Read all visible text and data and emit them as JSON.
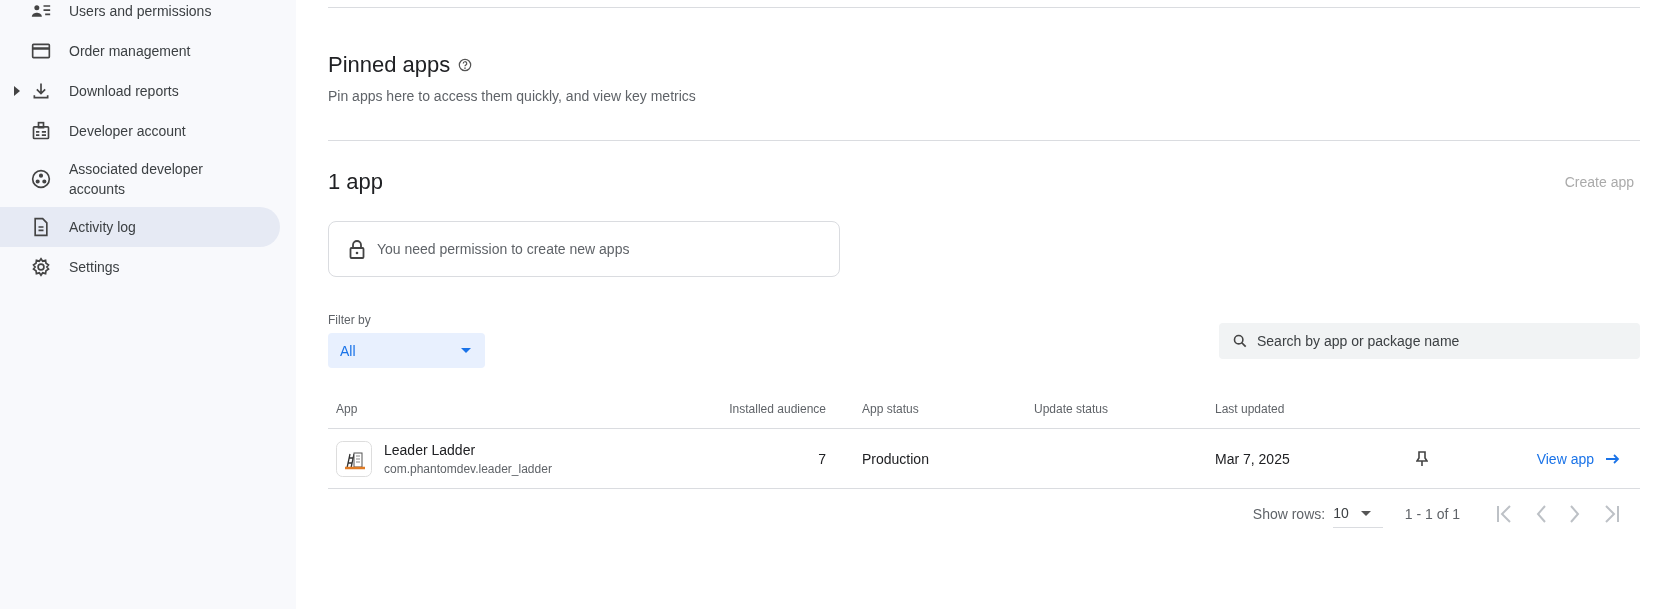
{
  "sidebar": {
    "items": [
      {
        "label": "Users and permissions",
        "selected": false
      },
      {
        "label": "Order management",
        "selected": false
      },
      {
        "label": "Download reports",
        "selected": false,
        "expanded": false
      },
      {
        "label": "Developer account",
        "selected": false
      },
      {
        "label": "Associated developer accounts",
        "selected": false
      },
      {
        "label": "Activity log",
        "selected": true
      },
      {
        "label": "Settings",
        "selected": false
      }
    ]
  },
  "pinned": {
    "title": "Pinned apps",
    "subtitle": "Pin apps here to access them quickly, and view key metrics"
  },
  "apps": {
    "count": "1 app",
    "create_button": {
      "label": "Create app",
      "disabled": true
    },
    "notice": "You need permission to create new apps",
    "filter": {
      "label": "Filter by",
      "value": "All"
    },
    "search": {
      "placeholder": "Search by app or package name"
    },
    "table": {
      "columns": [
        "App",
        "Installed audience",
        "App status",
        "Update status",
        "Last updated"
      ],
      "rows": [
        {
          "name": "Leader Ladder",
          "package": "com.phantomdev.leader_ladder",
          "audience": "7",
          "status": "Production",
          "last_updated": "Mar 7, 2025",
          "pinned": false,
          "action": "View app"
        }
      ]
    },
    "pagination": {
      "rows_label": "Show rows:",
      "rows_value": "10",
      "range": "1 - 1 of 1",
      "first_disabled": true,
      "prev_disabled": true,
      "next_disabled": true,
      "last_disabled": true
    }
  }
}
